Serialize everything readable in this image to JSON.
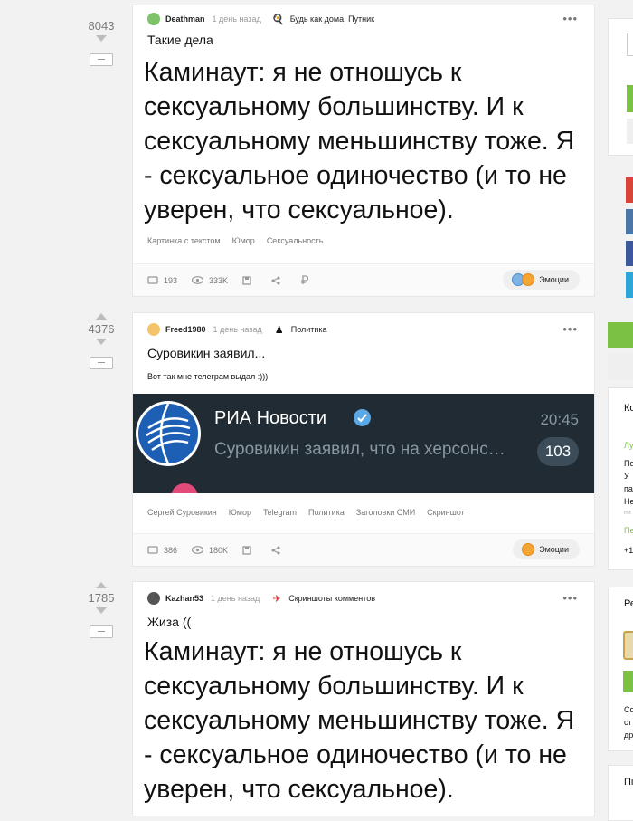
{
  "posts": [
    {
      "rating": "8043",
      "author": "Deathman",
      "time": "1 день назад",
      "community": "Будь как дома, Путник",
      "title": "Такие дела",
      "image_text": "Каминаут: я не отношусь к сексуальному большинству. И к сексуальному меньшинству тоже. Я - сексуальное одиночество (и то не уверен, что сексуальное).",
      "tags": [
        "Картинка с текстом",
        "Юмор",
        "Сексуальность"
      ],
      "comments": "193",
      "views": "333K",
      "emotions_label": "Эмоции"
    },
    {
      "rating": "4376",
      "author": "Freed1980",
      "time": "1 день назад",
      "community": "Политика",
      "title": "Суровикин заявил...",
      "body": "Вот так мне телеграм выдал :)))",
      "ria": {
        "channel": "РИА Новости",
        "time": "20:45",
        "message": "Суровикин заявил, что на херсонском",
        "unread": "103"
      },
      "tags": [
        "Сергей Суровикин",
        "Юмор",
        "Telegram",
        "Политика",
        "Заголовки СМИ",
        "Скриншот"
      ],
      "comments": "386",
      "views": "180K",
      "emotions_label": "Эмоции"
    },
    {
      "rating": "1785",
      "author": "Kazhan53",
      "time": "1 день назад",
      "community": "Скриншоты комментов",
      "title": "Жиза ((",
      "image_text": "Каминаут: я не отношусь к сексуальному большинству. И к сексуальному меньшинству тоже. Я - сексуальное одиночество (и то не уверен, что сексуальное)."
    }
  ],
  "sidebar": {
    "ko": "Ко",
    "lu": "Лу",
    "po": "По",
    "u": "У",
    "pa": "па",
    "ne": "Не",
    "ni": "ни",
    "pe": "Пе",
    "plus1": "+1",
    "re": "Ре",
    "so": "Со",
    "st": "ст",
    "dr": "др",
    "pi": "Пі"
  },
  "colors": {
    "green": "#7bc143",
    "text": "#111111",
    "muted": "#9a9a9a"
  }
}
